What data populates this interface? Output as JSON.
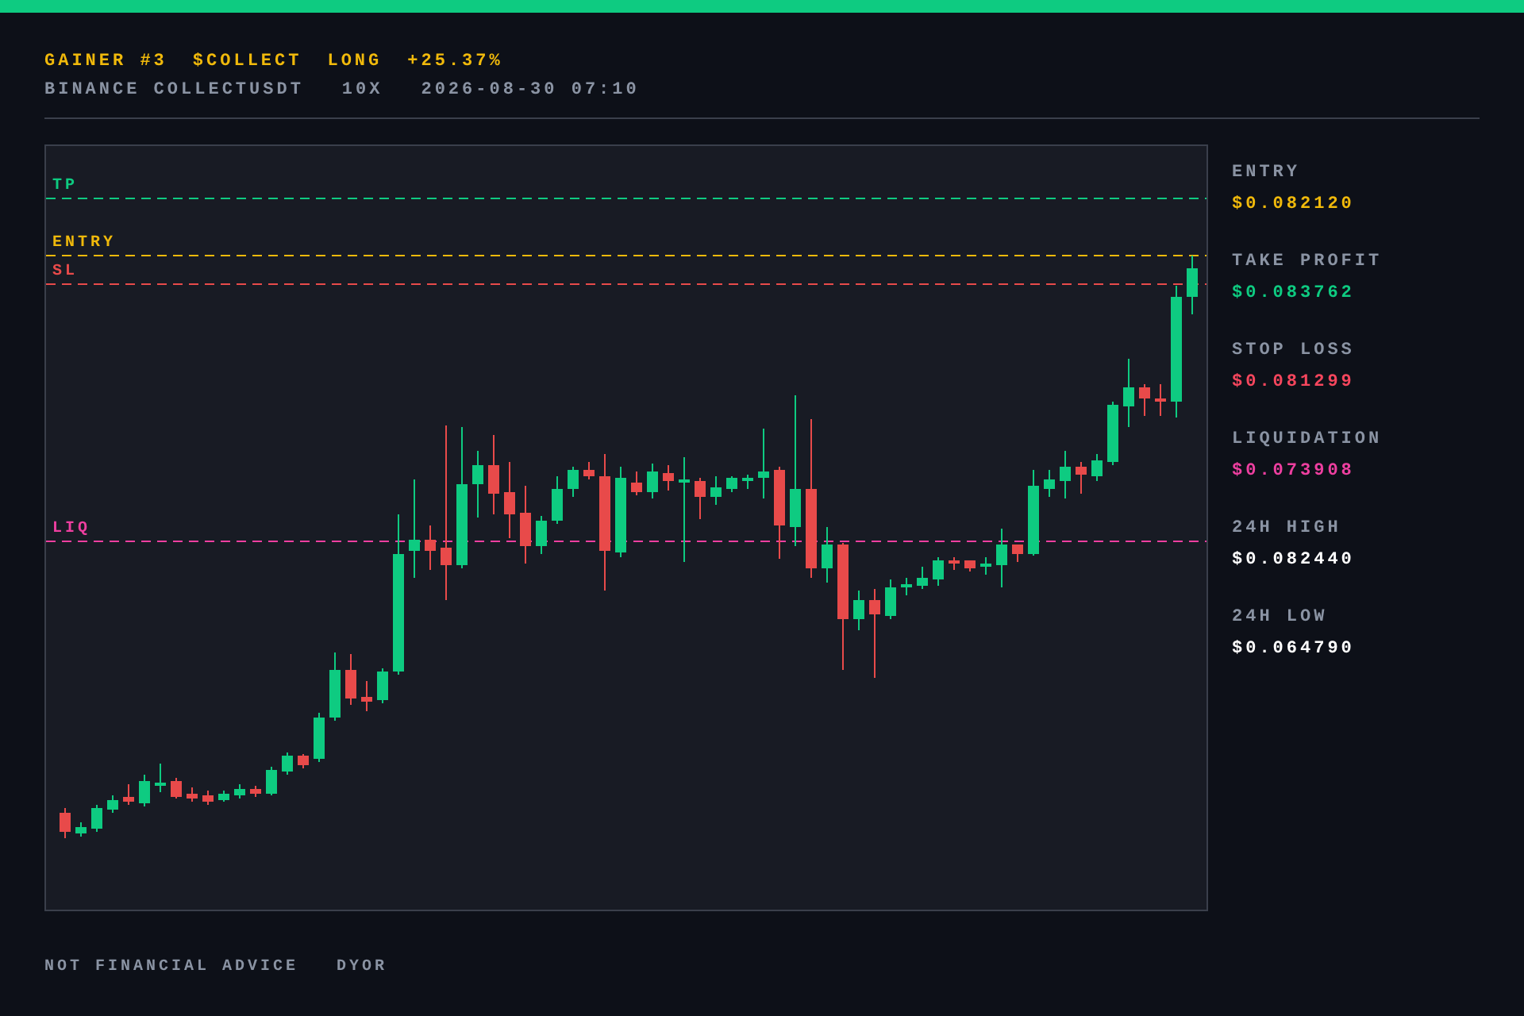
{
  "header": {
    "title_parts": [
      "GAINER #3",
      "$COLLECT",
      "LONG",
      "+25.37%"
    ],
    "subtitle_parts": [
      "BINANCE COLLECTUSDT",
      "10X",
      "2026-08-30 07:10"
    ]
  },
  "chart": {
    "levels": [
      {
        "label": "TP",
        "color": "#0ecb81"
      },
      {
        "label": "ENTRY",
        "color": "#f0b90b"
      },
      {
        "label": "SL",
        "color": "#e84a4a"
      },
      {
        "label": "LIQ",
        "color": "#ee3fa0"
      }
    ]
  },
  "stats": [
    {
      "label": "ENTRY",
      "value": "$0.082120",
      "color": "#f0b90b"
    },
    {
      "label": "TAKE PROFIT",
      "value": "$0.083762",
      "color": "#0ecb81"
    },
    {
      "label": "STOP LOSS",
      "value": "$0.081299",
      "color": "#f6465d"
    },
    {
      "label": "LIQUIDATION",
      "value": "$0.073908",
      "color": "#ee3fa0"
    },
    {
      "label": "24H HIGH",
      "value": "$0.082440",
      "color": "#ffffff"
    },
    {
      "label": "24H LOW",
      "value": "$0.064790",
      "color": "#ffffff"
    }
  ],
  "footer": [
    "NOT FINANCIAL ADVICE",
    "DYOR"
  ]
}
